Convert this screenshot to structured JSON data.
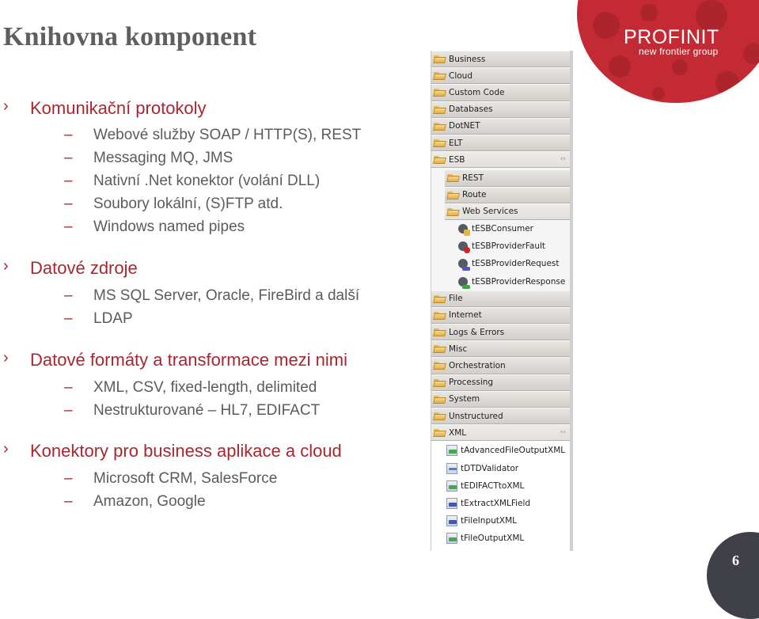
{
  "slide": {
    "title": "Knihovna komponent",
    "page_number": "6"
  },
  "logo": {
    "brand": "PROFINIT",
    "tagline": "new frontier group",
    "color": "#c42a34"
  },
  "colors": {
    "accent": "#a9262f",
    "body_text": "#5b5b5b",
    "title_text": "#5f5f5f",
    "page_badge": "#3f4048"
  },
  "bullets": [
    {
      "label": "Komunikační protokoly",
      "items": [
        "Webové služby SOAP / HTTP(S), REST",
        "Messaging MQ, JMS",
        "Nativní .Net konektor (volání DLL)",
        "Soubory lokální, (S)FTP atd.",
        "Windows named pipes"
      ]
    },
    {
      "label": "Datové zdroje",
      "items": [
        "MS SQL Server, Oracle, FireBird a další",
        "LDAP"
      ]
    },
    {
      "label": "Datové formáty a transformace mezi nimi",
      "items": [
        "XML, CSV, fixed-length, delimited",
        "Nestrukturované – HL7, EDIFACT"
      ]
    },
    {
      "label": "Konektory pro business aplikace a cloud",
      "items": [
        "Microsoft CRM, SalesForce",
        "Amazon, Google"
      ]
    }
  ],
  "palette": {
    "folders_top": [
      "Business",
      "Cloud",
      "Custom Code",
      "Databases",
      "DotNET",
      "ELT"
    ],
    "esb": {
      "label": "ESB",
      "expanded": true,
      "subfolders": [
        "REST",
        "Route"
      ],
      "web_services": {
        "label": "Web Services",
        "components": [
          "tESBConsumer",
          "tESBProviderFault",
          "tESBProviderRequest",
          "tESBProviderResponse"
        ]
      }
    },
    "folders_mid": [
      "File",
      "Internet",
      "Logs & Errors",
      "Misc",
      "Orchestration",
      "Processing",
      "System",
      "Unstructured"
    ],
    "xml": {
      "label": "XML",
      "expanded": true,
      "components": [
        "tAdvancedFileOutputXML",
        "tDTDValidator",
        "tEDIFACTtoXML",
        "tExtractXMLField",
        "tFileInputXML",
        "tFileOutputXML"
      ]
    },
    "collapse_glyph": "‹›"
  }
}
